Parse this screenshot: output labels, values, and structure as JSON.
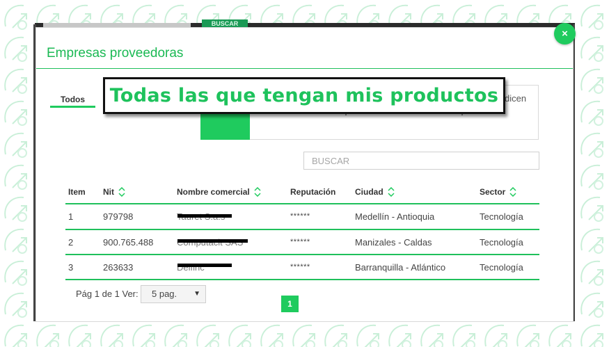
{
  "background_text": {
    "search_button": "BUSCAR"
  },
  "modal": {
    "title": "Empresas proveedoras",
    "close_label": "×",
    "tab_all": "Todos",
    "info_partial_text": "dicen",
    "callout": "Todas las que tengan mis productos",
    "search_placeholder": "BUSCAR"
  },
  "table": {
    "headers": [
      "Item",
      "Nit",
      "Nombre comercial",
      "Reputación",
      "Ciudad",
      "Sector"
    ],
    "rows": [
      [
        "1",
        "979798",
        "Tauret S.a.s",
        "******",
        "Medellín - Antioquia",
        "Tecnología"
      ],
      [
        "2",
        "900.765.488",
        "Computacit SAS",
        "******",
        "Manizales - Caldas",
        "Tecnología"
      ],
      [
        "3",
        "263633",
        "Delfinc",
        "******",
        "Barranquilla - Atlántico",
        "Tecnología"
      ]
    ]
  },
  "pagination": {
    "label": "Pág 1 de 1 Ver:",
    "per_page": "5 pag.",
    "current_page": "1"
  },
  "colors": {
    "accent": "#1fcb5e",
    "text": "#444444",
    "border": "#cfcfcf"
  }
}
